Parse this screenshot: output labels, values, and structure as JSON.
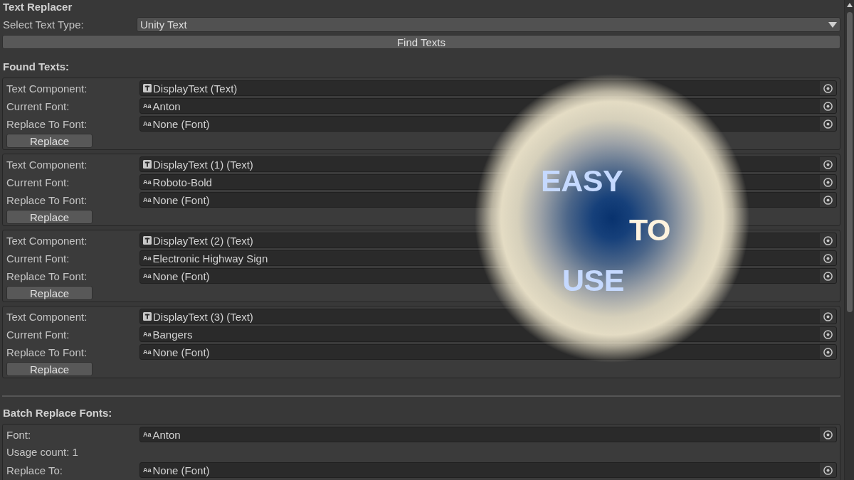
{
  "window": {
    "title": "Text Replacer"
  },
  "text_type": {
    "label": "Select Text Type:",
    "value": "Unity Text"
  },
  "find_button": "Find Texts",
  "found_texts": {
    "heading": "Found Texts:",
    "items": [
      {
        "fields": [
          {
            "kind": "component",
            "label": "Text Component:",
            "value": "DisplayText (Text)"
          },
          {
            "kind": "font",
            "label": "Current Font:",
            "icon_glyph": "Aa",
            "value": "Anton"
          },
          {
            "kind": "font",
            "label": "Replace To Font:",
            "icon_glyph": "Aa",
            "value": "None (Font)"
          }
        ],
        "button": "Replace"
      },
      {
        "fields": [
          {
            "kind": "component",
            "label": "Text Component:",
            "value": "DisplayText (1) (Text)"
          },
          {
            "kind": "font",
            "label": "Current Font:",
            "icon_glyph": "Aa",
            "value": "Roboto-Bold"
          },
          {
            "kind": "font",
            "label": "Replace To Font:",
            "icon_glyph": "Aa",
            "value": "None (Font)"
          }
        ],
        "button": "Replace"
      },
      {
        "fields": [
          {
            "kind": "component",
            "label": "Text Component:",
            "value": "DisplayText (2) (Text)"
          },
          {
            "kind": "font",
            "label": "Current Font:",
            "icon_glyph": "Aa",
            "value": "Electronic Highway Sign"
          },
          {
            "kind": "font",
            "label": "Replace To Font:",
            "icon_glyph": "Aa",
            "value": "None (Font)"
          }
        ],
        "button": "Replace"
      },
      {
        "fields": [
          {
            "kind": "component",
            "label": "Text Component:",
            "value": "DisplayText (3) (Text)"
          },
          {
            "kind": "font",
            "label": "Current Font:",
            "icon_glyph": "Aa",
            "value": "Bangers"
          },
          {
            "kind": "font",
            "label": "Replace To Font:",
            "icon_glyph": "Aa",
            "value": "None (Font)"
          }
        ],
        "button": "Replace"
      }
    ]
  },
  "batch": {
    "heading": "Batch Replace Fonts:",
    "rows": [
      {
        "kind": "font",
        "label": "Font:",
        "icon_glyph": "Aa",
        "value": "Anton"
      },
      {
        "kind": "info",
        "label": "Usage count: 1"
      },
      {
        "kind": "font",
        "label": "Replace To:",
        "icon_glyph": "Aa",
        "value": "None (Font)"
      }
    ]
  },
  "overlay": {
    "words": [
      {
        "text": "EASY",
        "color": "#c5d9ff"
      },
      {
        "text": "TO",
        "color": "#fff3df"
      },
      {
        "text": "USE",
        "color": "#c5d9ff"
      }
    ]
  }
}
